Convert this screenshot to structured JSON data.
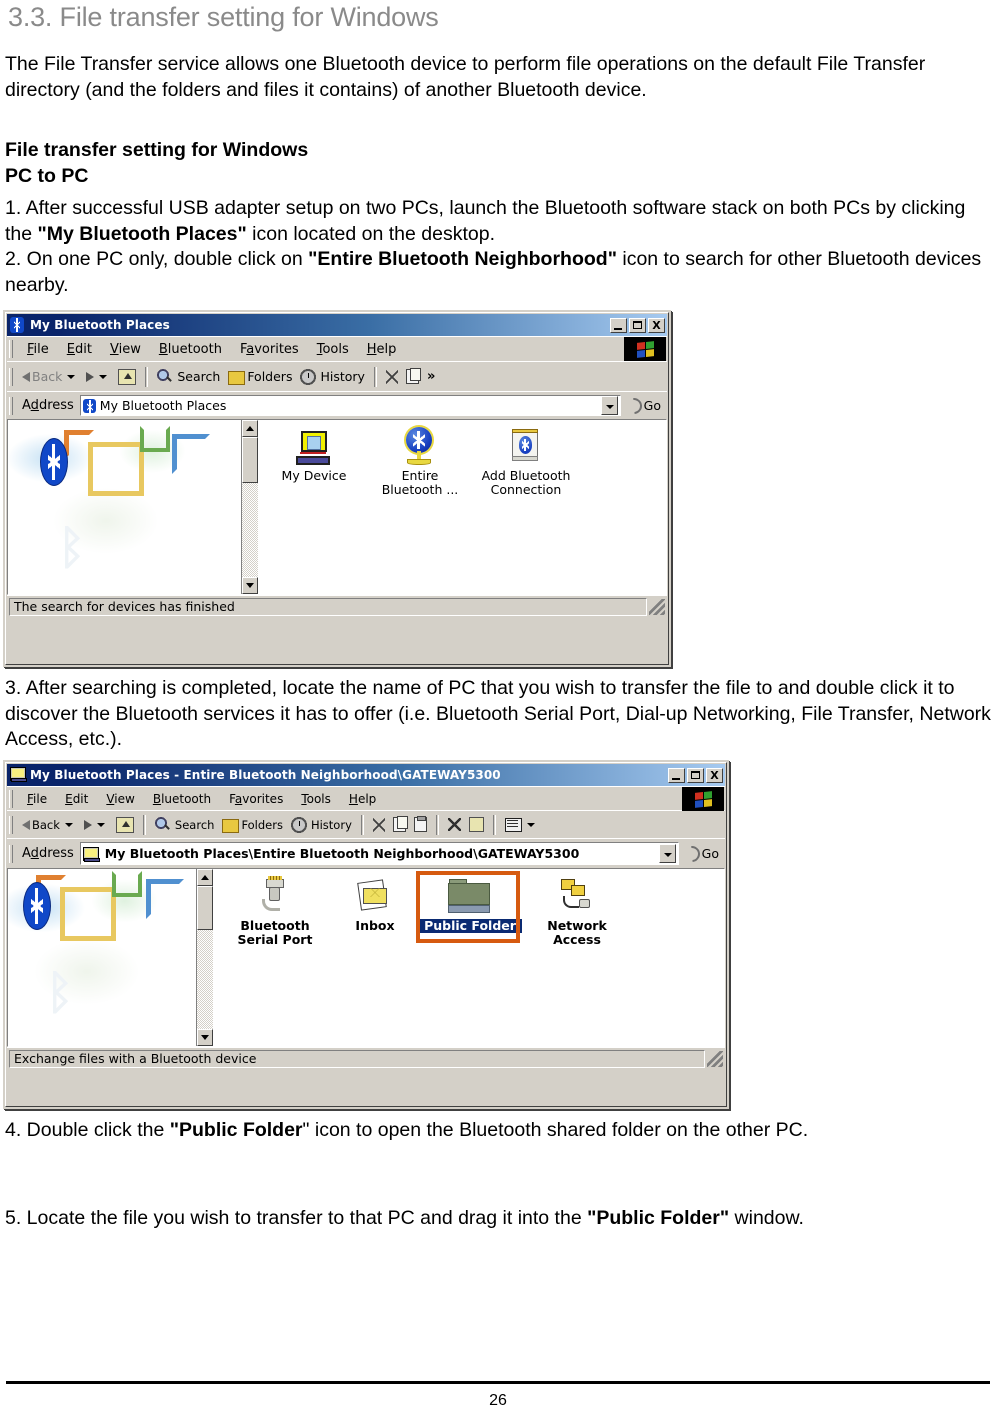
{
  "document": {
    "heading": "3.3. File transfer setting for Windows",
    "intro_paragraph": "The File Transfer service allows one Bluetooth device to perform file operations on the default File Transfer directory (and the folders and files it contains) of another Bluetooth device.",
    "subheading_1": "File transfer setting for Windows",
    "subheading_2": "PC to PC",
    "step1_pre": "1. After successful USB adapter setup on two PCs, launch the Bluetooth software stack on both PCs by clicking the ",
    "step1_bold": "\"My Bluetooth Places\"",
    "step1_post": " icon located on the desktop.",
    "step2_pre": "2. On one PC only, double click on ",
    "step2_bold": "\"Entire Bluetooth Neighborhood\"",
    "step2_post": " icon to search for other Bluetooth devices nearby.",
    "step3": "3. After searching is completed, locate the name of PC that you wish to transfer the file to and double click it to discover the Bluetooth services it has to offer (i.e. Bluetooth Serial Port, Dial-up Networking, File Transfer, Network Access, etc.).",
    "step4_pre": "4. Double click the ",
    "step4_bold": "\"Public Folder\"",
    "step4_post": "\" icon to open the Bluetooth shared folder on the other PC.",
    "step5_pre": "5. Locate the file you wish to transfer to that PC and drag it into the ",
    "step5_bold": "\"Public Folder\"",
    "step5_post": " window.",
    "page_number": "26"
  },
  "window1": {
    "title": "My Bluetooth Places",
    "title_icon": "bluetooth-icon",
    "buttons": {
      "minimize": "_",
      "maximize": "□",
      "close": "X"
    },
    "menu": [
      {
        "label": "File",
        "accel": "F"
      },
      {
        "label": "Edit",
        "accel": "E"
      },
      {
        "label": "View",
        "accel": "V"
      },
      {
        "label": "Bluetooth",
        "accel": "B"
      },
      {
        "label": "Favorites",
        "accel": "a"
      },
      {
        "label": "Tools",
        "accel": "T"
      },
      {
        "label": "Help",
        "accel": "H"
      }
    ],
    "toolbar": [
      {
        "label": "Back",
        "icon": "back-arrow-icon",
        "disabled": true
      },
      {
        "label": "",
        "icon": "forward-arrow-icon",
        "disabled": false
      },
      {
        "label": "",
        "icon": "up-folder-icon",
        "disabled": false
      },
      {
        "label": "Search",
        "icon": "search-icon",
        "disabled": false
      },
      {
        "label": "Folders",
        "icon": "folders-icon",
        "disabled": false
      },
      {
        "label": "History",
        "icon": "history-icon",
        "disabled": false
      },
      {
        "label": "",
        "icon": "cut-icon",
        "disabled": false
      },
      {
        "label": "",
        "icon": "copy-icon",
        "disabled": false
      },
      {
        "label": "»",
        "icon": "chevron-overflow-icon",
        "disabled": false
      }
    ],
    "address": {
      "label": "Address",
      "value": "My Bluetooth Places",
      "icon": "bluetooth-icon",
      "go_label": "Go"
    },
    "items": [
      {
        "caption": "My Device",
        "caption2": "",
        "icon": "my-device-icon",
        "selected": false
      },
      {
        "caption": "Entire",
        "caption2": "Bluetooth ...",
        "icon": "globe-icon",
        "selected": false
      },
      {
        "caption": "Add Bluetooth",
        "caption2": "Connection",
        "icon": "add-bluetooth-connection-icon",
        "selected": false
      }
    ],
    "statusbar": "The search for devices has finished"
  },
  "window2": {
    "title": "My Bluetooth Places - Entire Bluetooth Neighborhood\\GATEWAY5300",
    "title_icon": "computer-icon",
    "buttons": {
      "minimize": "_",
      "maximize": "□",
      "close": "X"
    },
    "menu": [
      {
        "label": "File",
        "accel": "F"
      },
      {
        "label": "Edit",
        "accel": "E"
      },
      {
        "label": "View",
        "accel": "V"
      },
      {
        "label": "Bluetooth",
        "accel": "B"
      },
      {
        "label": "Favorites",
        "accel": "a"
      },
      {
        "label": "Tools",
        "accel": "T"
      },
      {
        "label": "Help",
        "accel": "H"
      }
    ],
    "toolbar": [
      {
        "label": "Back",
        "icon": "back-arrow-icon",
        "disabled": false
      },
      {
        "label": "",
        "icon": "forward-arrow-icon",
        "disabled": true
      },
      {
        "label": "",
        "icon": "up-folder-icon",
        "disabled": false
      },
      {
        "label": "Search",
        "icon": "search-icon",
        "disabled": false
      },
      {
        "label": "Folders",
        "icon": "folders-icon",
        "disabled": false
      },
      {
        "label": "History",
        "icon": "history-icon",
        "disabled": false
      },
      {
        "label": "",
        "icon": "cut-icon",
        "disabled": false
      },
      {
        "label": "",
        "icon": "copy-icon",
        "disabled": false
      },
      {
        "label": "",
        "icon": "paste-icon",
        "disabled": false
      },
      {
        "label": "",
        "icon": "delete-icon",
        "disabled": false
      },
      {
        "label": "",
        "icon": "undo-icon",
        "disabled": false
      },
      {
        "label": "",
        "icon": "views-icon",
        "disabled": false
      }
    ],
    "address": {
      "label": "Address",
      "value": "My Bluetooth Places\\Entire Bluetooth Neighborhood\\GATEWAY5300",
      "icon": "computer-icon",
      "go_label": "Go"
    },
    "items": [
      {
        "caption": "Bluetooth",
        "caption2": "Serial Port",
        "icon": "bluetooth-serial-port-icon",
        "selected": false
      },
      {
        "caption": "Inbox",
        "caption2": "",
        "icon": "inbox-icon",
        "selected": false
      },
      {
        "caption": "Public Folder",
        "caption2": "",
        "icon": "public-folder-icon",
        "selected": true
      },
      {
        "caption": "Network",
        "caption2": "Access",
        "icon": "network-access-icon",
        "selected": false
      }
    ],
    "statusbar": "Exchange files with a Bluetooth device",
    "selection_highlight_color": "#d65a10"
  }
}
